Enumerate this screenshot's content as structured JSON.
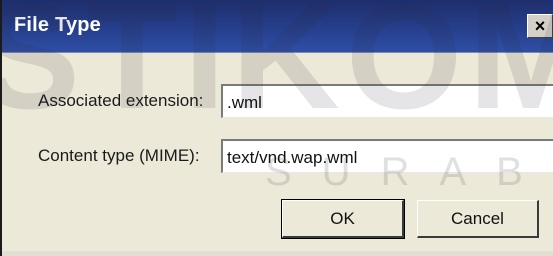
{
  "dialog": {
    "title": "File Type",
    "close_label": "×"
  },
  "form": {
    "extension_label": "Associated extension:",
    "extension_value": ".wml",
    "mime_label": "Content type (MIME):",
    "mime_value": "text/vnd.wap.wml"
  },
  "buttons": {
    "ok_label": "OK",
    "cancel_label": "Cancel"
  },
  "watermark": {
    "main": "STIKOM",
    "sub": "SURABAYA"
  },
  "colors": {
    "titlebar": "#263f8c",
    "dialog_background": "#ece9d8",
    "field_background": "#ffffff"
  }
}
